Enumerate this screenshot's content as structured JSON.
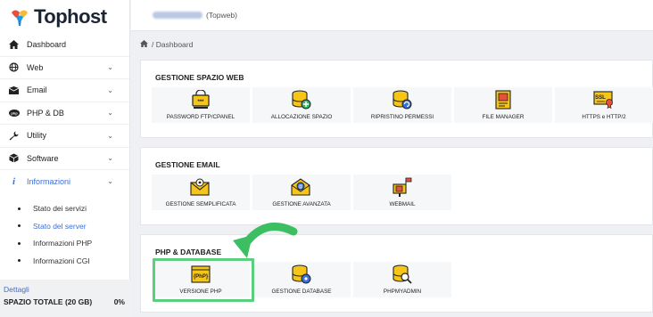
{
  "brand": {
    "name": "Tophost"
  },
  "header": {
    "account_suffix": "(Topweb)"
  },
  "breadcrumb": {
    "sep": "/",
    "current": "Dashboard"
  },
  "sidebar": {
    "items": [
      {
        "label": "Dashboard",
        "icon": "home-icon"
      },
      {
        "label": "Web",
        "icon": "globe-icon"
      },
      {
        "label": "Email",
        "icon": "envelope-icon"
      },
      {
        "label": "PHP & DB",
        "icon": "php-icon"
      },
      {
        "label": "Utility",
        "icon": "wrench-icon"
      },
      {
        "label": "Software",
        "icon": "cube-icon"
      },
      {
        "label": "Informazioni",
        "icon": "info-icon"
      }
    ],
    "sub_items": [
      "Stato dei servizi",
      "Stato del server",
      "Informazioni PHP",
      "Informazioni CGI"
    ],
    "footer": {
      "link": "Dettagli",
      "label": "SPAZIO TOTALE (20 GB)",
      "value": "0%"
    }
  },
  "sections": {
    "web": {
      "title": "GESTIONE SPAZIO WEB",
      "tiles": [
        "PASSWORD FTP/CPANEL",
        "ALLOCAZIONE SPAZIO",
        "RIPRISTINO PERMESSI",
        "FILE MANAGER",
        "HTTPS e HTTP/2"
      ]
    },
    "email": {
      "title": "GESTIONE EMAIL",
      "tiles": [
        "GESTIONE SEMPLIFICATA",
        "GESTIONE AVANZATA",
        "WEBMAIL"
      ]
    },
    "php": {
      "title": "PHP & DATABASE",
      "tiles": [
        "VERSIONE PHP",
        "GESTIONE DATABASE",
        "PHPMYADMIN"
      ],
      "php_badge": "{PhP}"
    }
  },
  "colors": {
    "accent": "#3a6fd8",
    "highlight": "#5ccf7e",
    "icon_yellow": "#f5c518"
  }
}
